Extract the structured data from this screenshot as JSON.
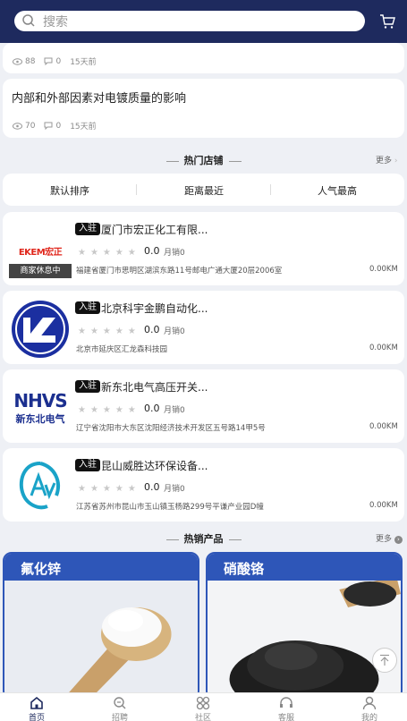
{
  "header": {
    "search_placeholder": "搜索"
  },
  "articles": [
    {
      "title": "",
      "views": "88",
      "comments": "0",
      "time": "15天前"
    },
    {
      "title": "内部和外部因素对电镀质量的影响",
      "views": "70",
      "comments": "0",
      "time": "15天前"
    }
  ],
  "hot_shops": {
    "title": "热门店铺",
    "more": "更多",
    "sort_options": [
      "默认排序",
      "距离最近",
      "人气最高"
    ],
    "shops": [
      {
        "badge": "入驻",
        "name": "厦门市宏正化工有限...",
        "rating": "0.0",
        "sales": "月销0",
        "address": "福建省厦门市思明区湖滨东路11号邮电广通大厦20层2006室",
        "distance": "0.00KM",
        "status": "商家休息中",
        "logo_text": "EKEM宏正"
      },
      {
        "badge": "入驻",
        "name": "北京科宇金鹏自动化...",
        "rating": "0.0",
        "sales": "月销0",
        "address": "北京市延庆区汇龙森科技园",
        "distance": "0.00KM"
      },
      {
        "badge": "入驻",
        "name": "新东北电气高压开关...",
        "rating": "0.0",
        "sales": "月销0",
        "address": "辽宁省沈阳市大东区沈阳经济技术开发区五号路14甲5号",
        "distance": "0.00KM",
        "logo_text_top": "NHVS",
        "logo_text_bottom": "新东北电气"
      },
      {
        "badge": "入驻",
        "name": "昆山威胜达环保设备...",
        "rating": "0.0",
        "sales": "月销0",
        "address": "江苏省苏州市昆山市玉山镇玉杨路299号平谦产业园D幢",
        "distance": "0.00KM"
      }
    ]
  },
  "hot_products": {
    "title": "热销产品",
    "more": "更多",
    "items": [
      {
        "label": "氟化锌"
      },
      {
        "label": "硝酸铬"
      }
    ]
  },
  "tabbar": [
    "首页",
    "招聘",
    "社区",
    "客服",
    "我的"
  ],
  "colors": {
    "brand": "#1e2a5e",
    "product_blue": "#2e56b8",
    "logo_red": "#e0261b"
  }
}
